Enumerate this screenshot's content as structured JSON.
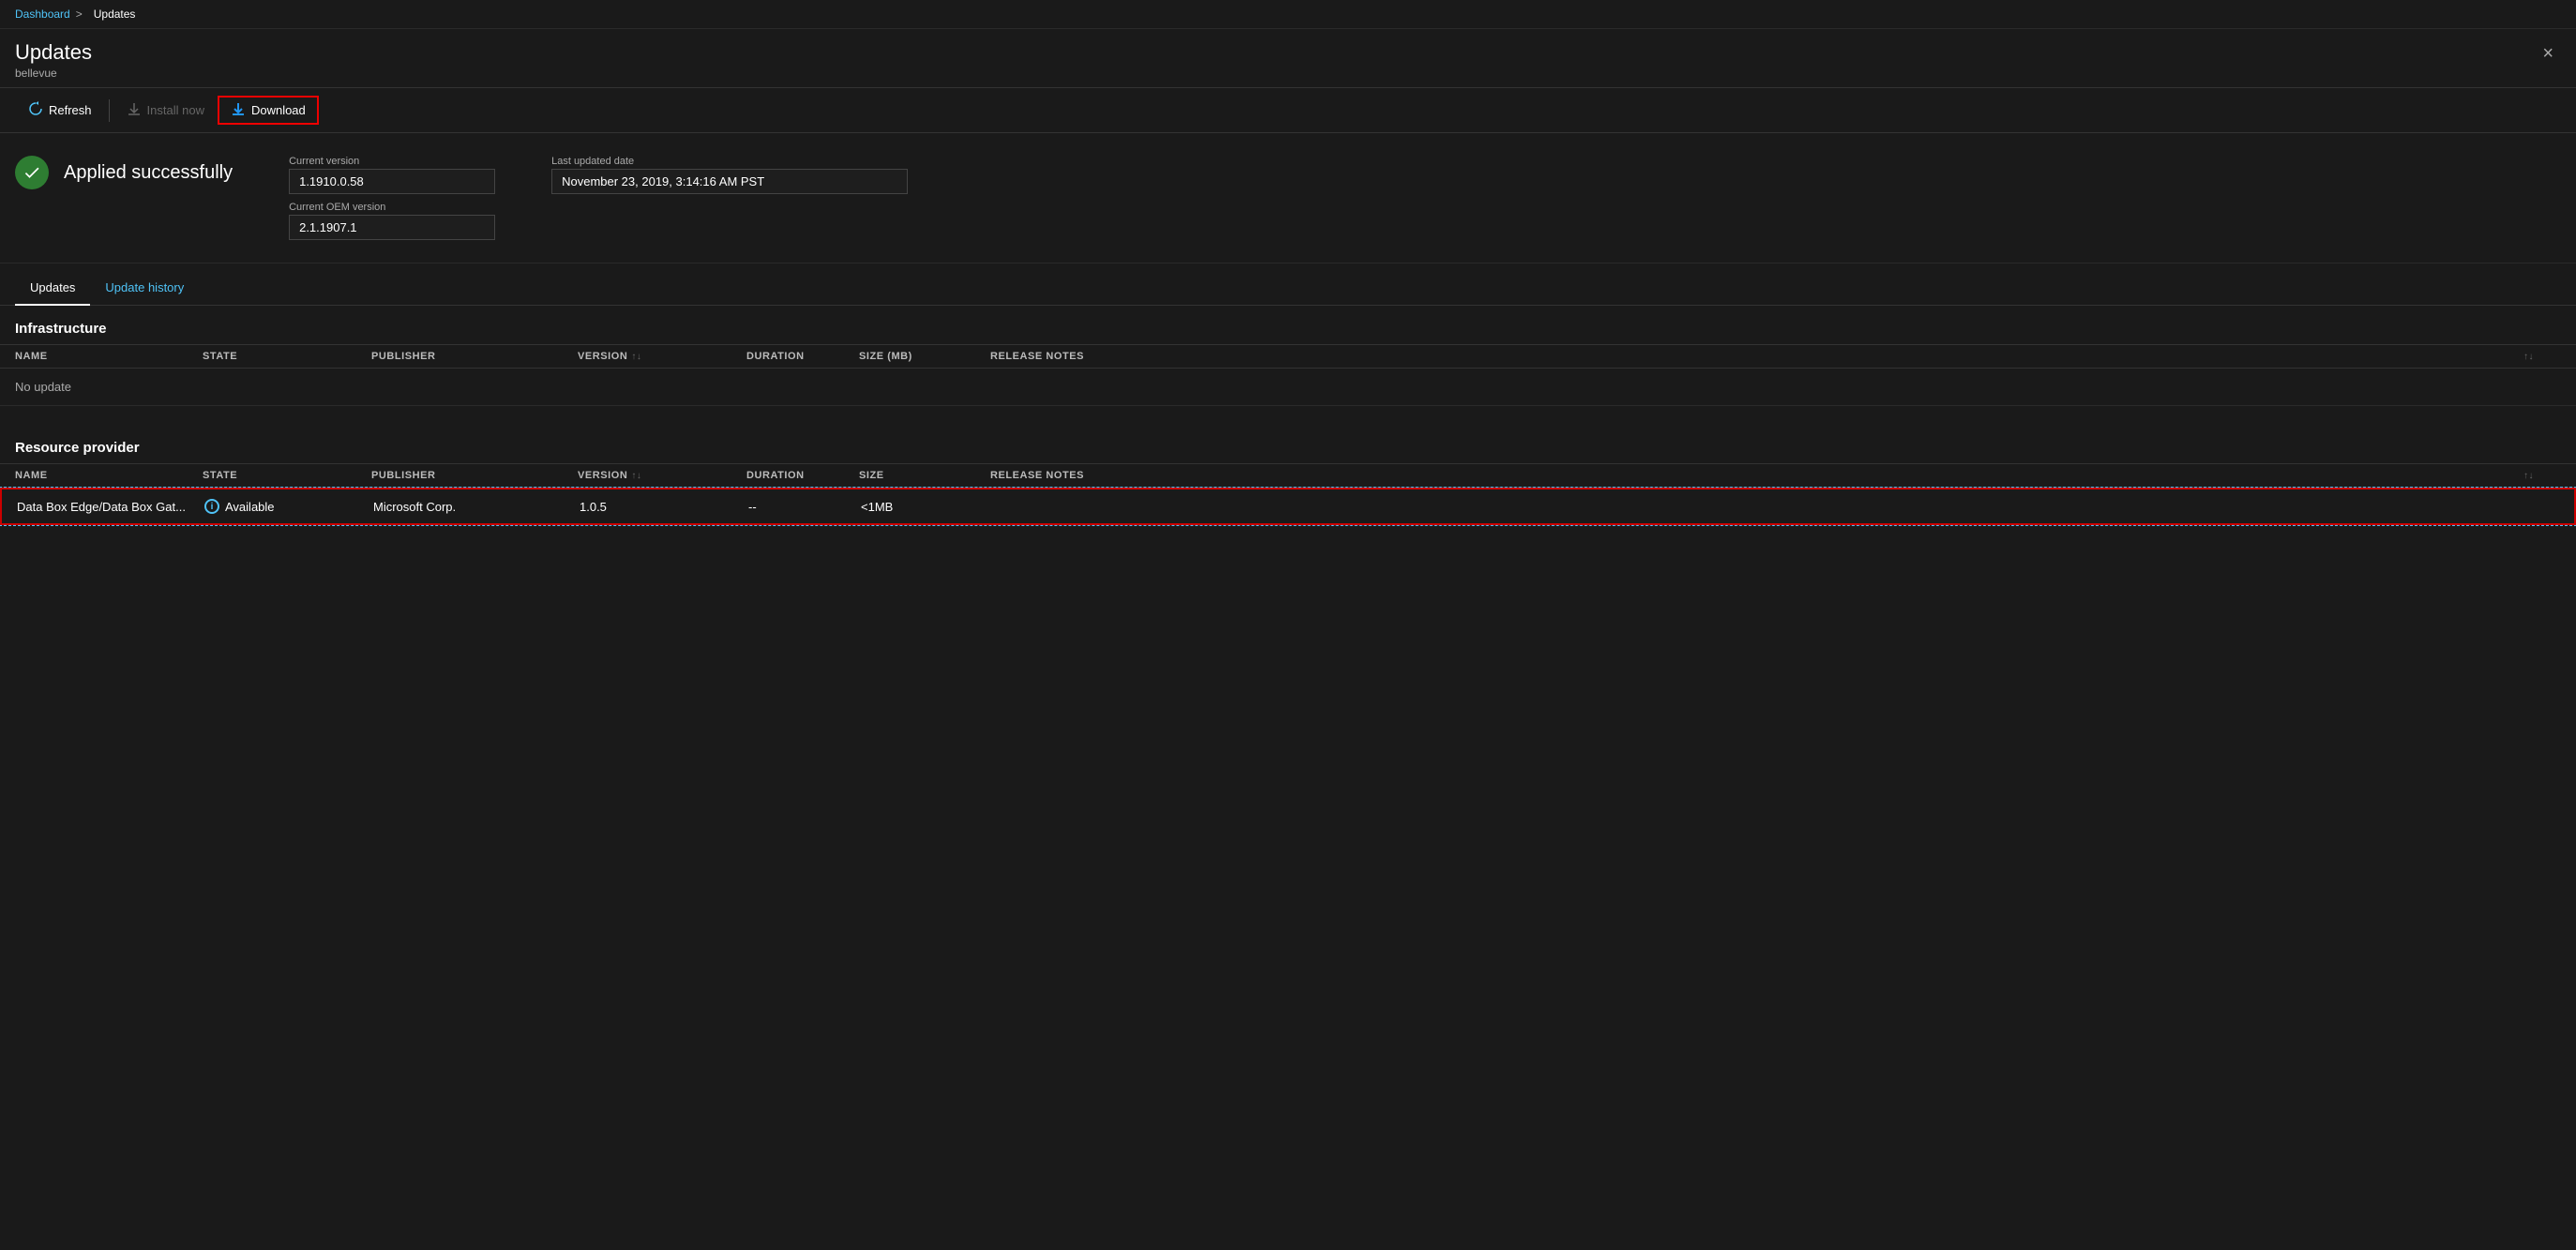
{
  "breadcrumb": {
    "parent_label": "Dashboard",
    "separator": ">",
    "current_label": "Updates"
  },
  "header": {
    "title": "Updates",
    "subtitle": "bellevue",
    "close_label": "×"
  },
  "toolbar": {
    "refresh_label": "Refresh",
    "install_label": "Install now",
    "download_label": "Download"
  },
  "status": {
    "message": "Applied successfully",
    "current_version_label": "Current version",
    "current_version_value": "1.1910.0.58",
    "current_oem_label": "Current OEM version",
    "current_oem_value": "2.1.1907.1",
    "last_updated_label": "Last updated date",
    "last_updated_value": "November 23, 2019, 3:14:16 AM PST"
  },
  "tabs": [
    {
      "label": "Updates",
      "active": true
    },
    {
      "label": "Update history",
      "active": false
    }
  ],
  "infrastructure": {
    "section_title": "Infrastructure",
    "columns": [
      "NAME",
      "STATE",
      "PUBLISHER",
      "VERSION",
      "DURATION",
      "SIZE (MB)",
      "RELEASE NOTES",
      ""
    ],
    "empty_message": "No update"
  },
  "resource_provider": {
    "section_title": "Resource provider",
    "columns": [
      "NAME",
      "STATE",
      "PUBLISHER",
      "VERSION",
      "DURATION",
      "SIZE",
      "RELEASE NOTES",
      ""
    ],
    "rows": [
      {
        "name": "Data Box Edge/Data Box Gat...",
        "state": "Available",
        "publisher": "Microsoft Corp.",
        "version": "1.0.5",
        "duration": "--",
        "size": "<1MB",
        "release_notes": ""
      }
    ]
  }
}
